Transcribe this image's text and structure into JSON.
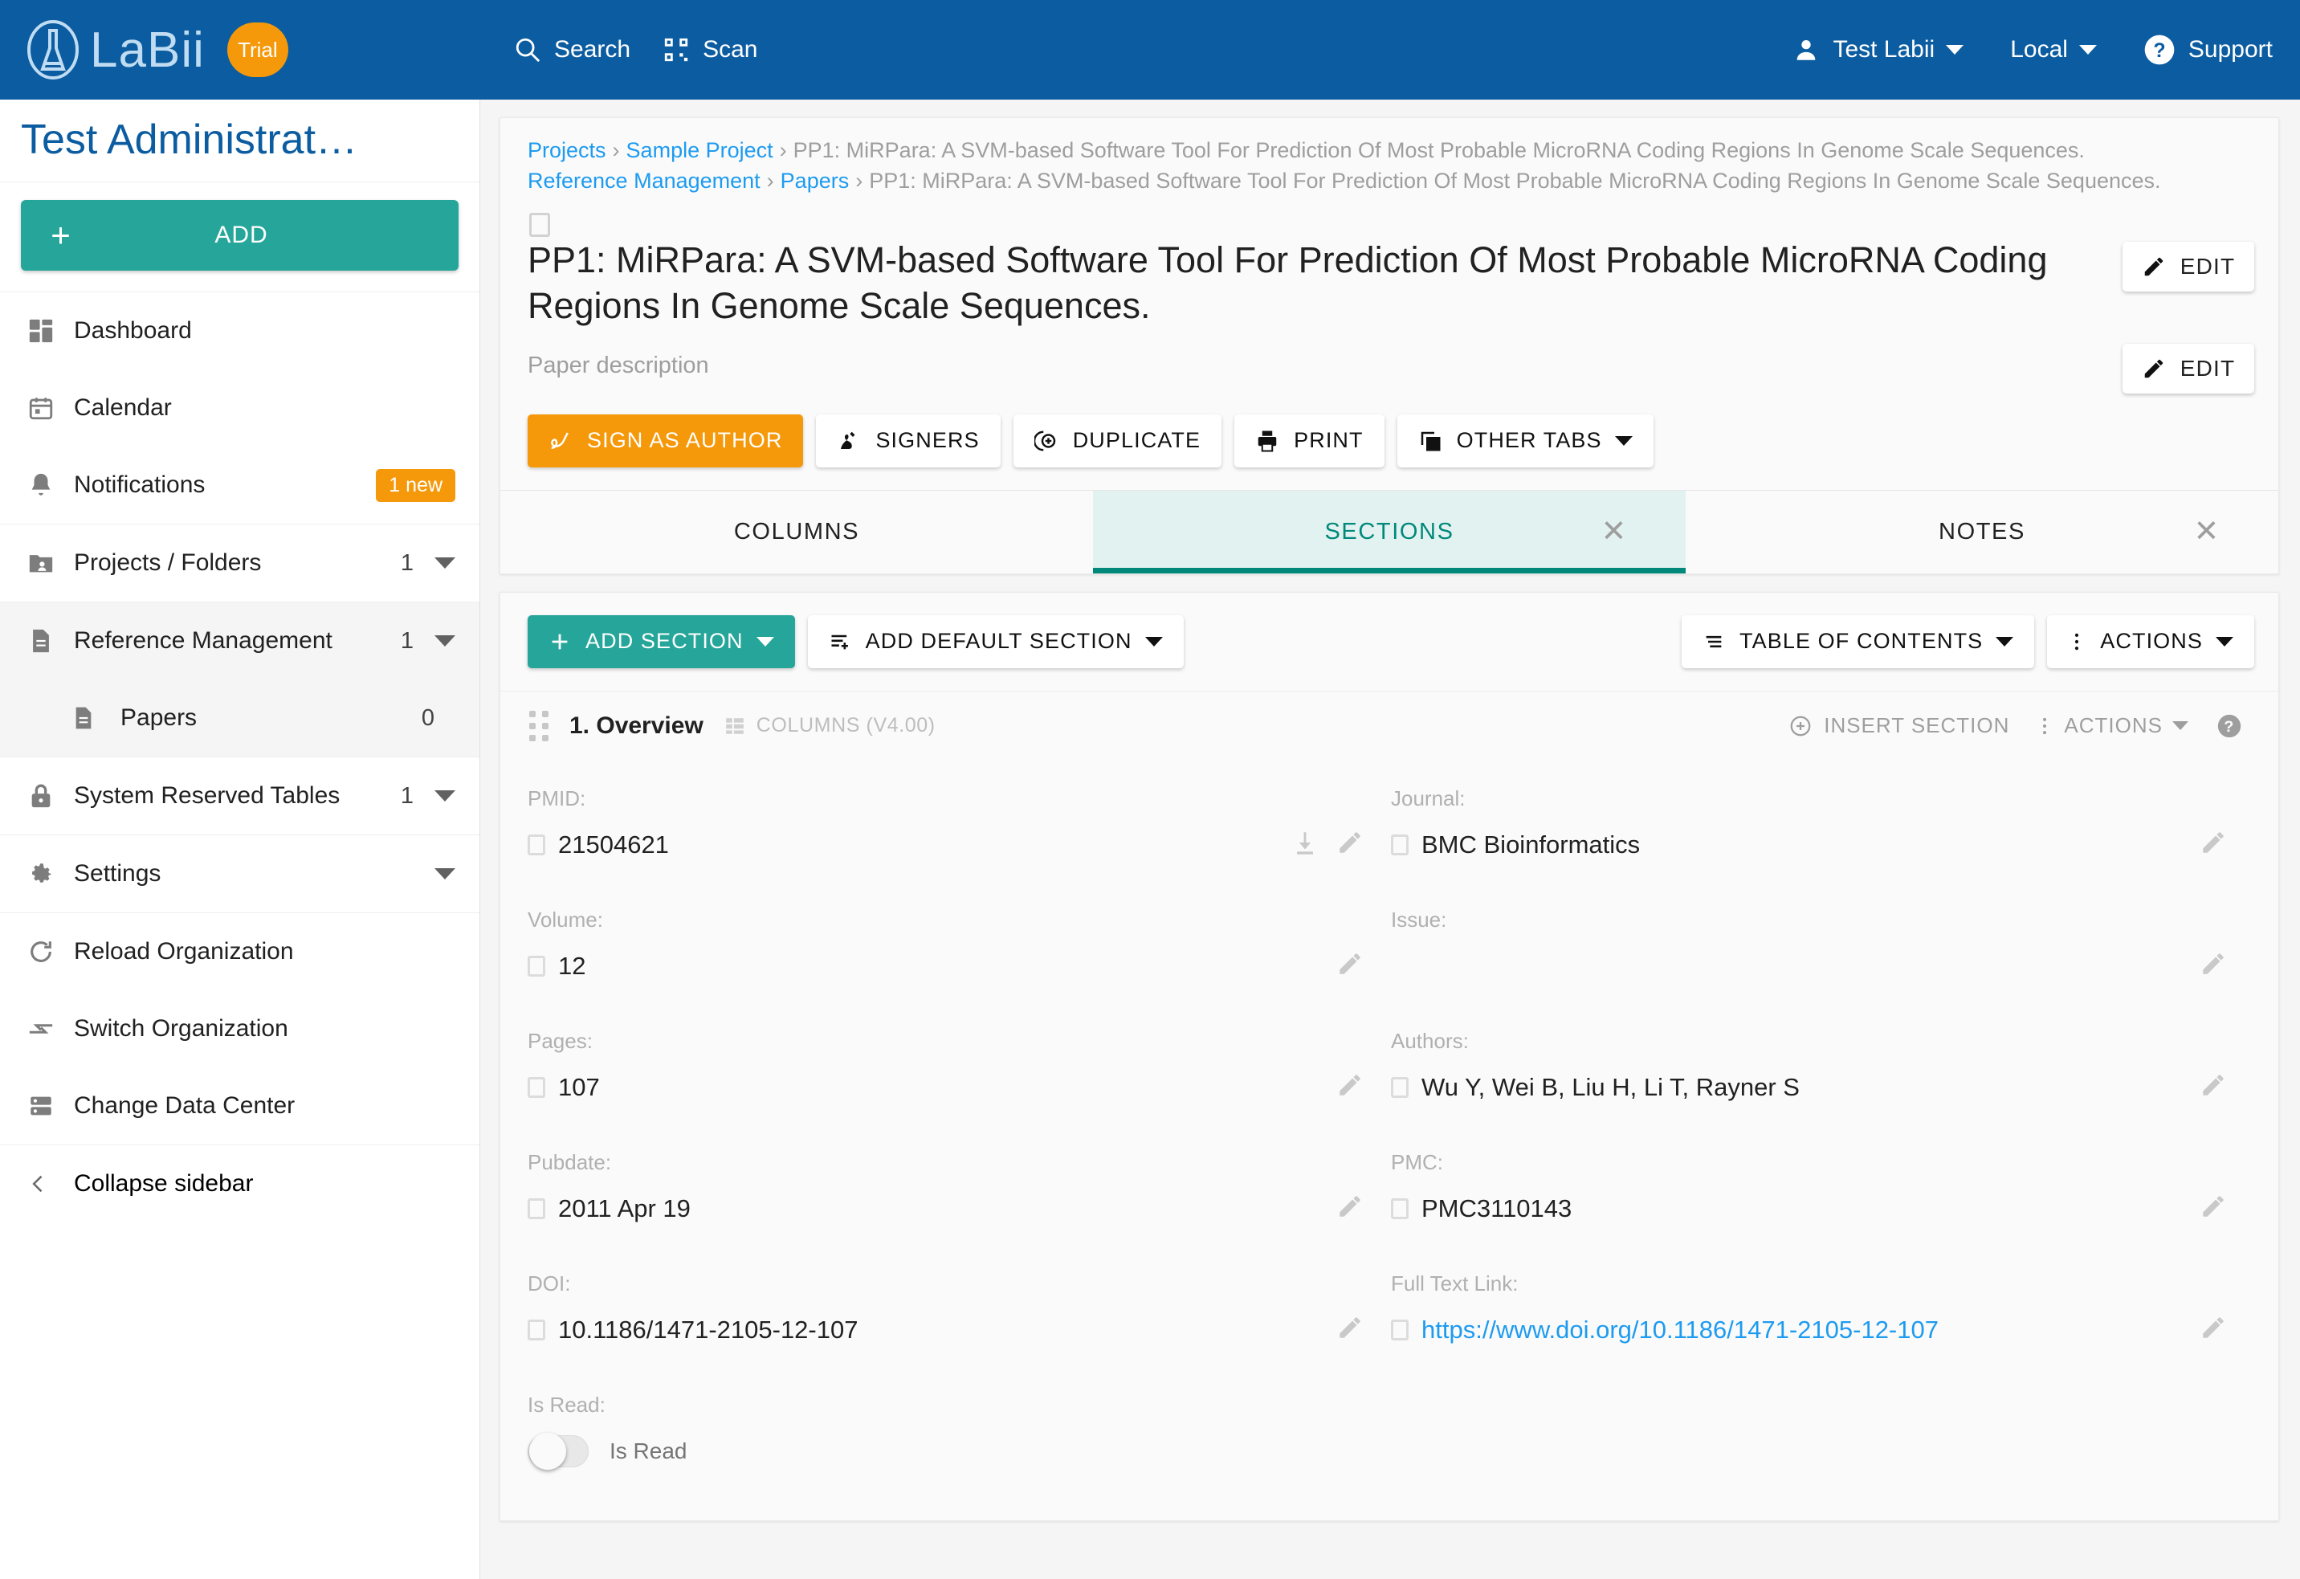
{
  "topbar": {
    "brand": "LaBii",
    "trial_label": "Trial",
    "search_label": "Search",
    "scan_label": "Scan",
    "user_label": "Test Labii",
    "locale_label": "Local",
    "support_label": "Support",
    "bg_color": "#0b5ca0",
    "trial_color": "#f5990a"
  },
  "sidebar": {
    "org_title": "Test Administrat…",
    "add_label": "ADD",
    "add_color": "#26a69a",
    "items": [
      {
        "label": "Dashboard",
        "icon": "dashboard-icon",
        "count": "",
        "badge": "",
        "caret": false
      },
      {
        "label": "Calendar",
        "icon": "calendar-icon",
        "count": "",
        "badge": "",
        "caret": false
      },
      {
        "label": "Notifications",
        "icon": "bell-icon",
        "count": "",
        "badge": "1 new",
        "caret": false
      },
      {
        "label": "Projects / Folders",
        "icon": "folder-shared-icon",
        "count": "1",
        "badge": "",
        "caret": true
      },
      {
        "label": "Reference Management",
        "icon": "document-icon",
        "count": "1",
        "badge": "",
        "caret": true
      },
      {
        "label": "Papers",
        "icon": "document-icon",
        "count": "0",
        "badge": "",
        "caret": false,
        "sub": true
      },
      {
        "label": "System Reserved Tables",
        "icon": "lock-icon",
        "count": "1",
        "badge": "",
        "caret": true
      },
      {
        "label": "Settings",
        "icon": "gear-icon",
        "count": "",
        "badge": "",
        "caret": true
      },
      {
        "label": "Reload Organization",
        "icon": "refresh-icon",
        "count": "",
        "badge": "",
        "caret": false
      },
      {
        "label": "Switch Organization",
        "icon": "switch-icon",
        "count": "",
        "badge": "",
        "caret": false
      },
      {
        "label": "Change Data Center",
        "icon": "server-icon",
        "count": "",
        "badge": "",
        "caret": false
      }
    ],
    "collapse_label": "Collapse sidebar"
  },
  "breadcrumbs": {
    "row1": [
      {
        "text": "Projects",
        "link": true
      },
      {
        "text": "Sample Project",
        "link": true
      },
      {
        "text": "PP1: MiRPara: A SVM-based Software Tool For Prediction Of Most Probable MicroRNA Coding Regions In Genome Scale Sequences.",
        "link": false
      }
    ],
    "row2": [
      {
        "text": "Reference Management",
        "link": true
      },
      {
        "text": "Papers",
        "link": true
      },
      {
        "text": "PP1: MiRPara: A SVM-based Software Tool For Prediction Of Most Probable MicroRNA Coding Regions In Genome Scale Sequences.",
        "link": false
      }
    ],
    "separator": "›"
  },
  "document": {
    "title": "PP1: MiRPara: A SVM-based Software Tool For Prediction Of Most Probable MicroRNA Coding Regions In Genome Scale Sequences.",
    "description_placeholder": "Paper description",
    "edit_title_label": "EDIT",
    "edit_desc_label": "EDIT"
  },
  "action_buttons": [
    {
      "label": "SIGN AS AUTHOR",
      "icon": "signature-icon",
      "primary": true,
      "caret": false
    },
    {
      "label": "SIGNERS",
      "icon": "signers-icon",
      "primary": false,
      "caret": false
    },
    {
      "label": "DUPLICATE",
      "icon": "duplicate-icon",
      "primary": false,
      "caret": false
    },
    {
      "label": "PRINT",
      "icon": "printer-icon",
      "primary": false,
      "caret": false
    },
    {
      "label": "OTHER TABS",
      "icon": "tabs-icon",
      "primary": false,
      "caret": true
    }
  ],
  "tabs": [
    {
      "label": "COLUMNS",
      "active": false,
      "closable": false
    },
    {
      "label": "SECTIONS",
      "active": true,
      "closable": true
    },
    {
      "label": "NOTES",
      "active": false,
      "closable": true
    }
  ],
  "section_toolbar": {
    "add_section": "ADD SECTION",
    "add_default_section": "ADD DEFAULT SECTION",
    "table_of_contents": "TABLE OF CONTENTS",
    "actions": "ACTIONS"
  },
  "section": {
    "number_title": "1. Overview",
    "meta": "COLUMNS (V4.00)",
    "insert_section": "INSERT SECTION",
    "actions": "ACTIONS",
    "help": "?"
  },
  "fields": [
    [
      {
        "label": "PMID:",
        "value": "21504621",
        "link": false,
        "checkbox": true,
        "download": true,
        "pencil": true
      },
      {
        "label": "Journal:",
        "value": "BMC Bioinformatics",
        "link": false,
        "checkbox": true,
        "download": false,
        "pencil": true
      }
    ],
    [
      {
        "label": "Volume:",
        "value": "12",
        "link": false,
        "checkbox": true,
        "download": false,
        "pencil": true
      },
      {
        "label": "Issue:",
        "value": "",
        "link": false,
        "checkbox": false,
        "download": false,
        "pencil": true
      }
    ],
    [
      {
        "label": "Pages:",
        "value": "107",
        "link": false,
        "checkbox": true,
        "download": false,
        "pencil": true
      },
      {
        "label": "Authors:",
        "value": "Wu Y, Wei B, Liu H, Li T, Rayner S",
        "link": false,
        "checkbox": true,
        "download": false,
        "pencil": true
      }
    ],
    [
      {
        "label": "Pubdate:",
        "value": "2011 Apr 19",
        "link": false,
        "checkbox": true,
        "download": false,
        "pencil": true
      },
      {
        "label": "PMC:",
        "value": "PMC3110143",
        "link": false,
        "checkbox": true,
        "download": false,
        "pencil": true
      }
    ],
    [
      {
        "label": "DOI:",
        "value": "10.1186/1471-2105-12-107",
        "link": false,
        "checkbox": true,
        "download": false,
        "pencil": true
      },
      {
        "label": "Full Text Link:",
        "value": "https://www.doi.org/10.1186/1471-2105-12-107",
        "link": true,
        "checkbox": true,
        "download": false,
        "pencil": true
      }
    ]
  ],
  "is_read": {
    "label": "Is Read:",
    "toggle_label": "Is Read",
    "on": false
  }
}
